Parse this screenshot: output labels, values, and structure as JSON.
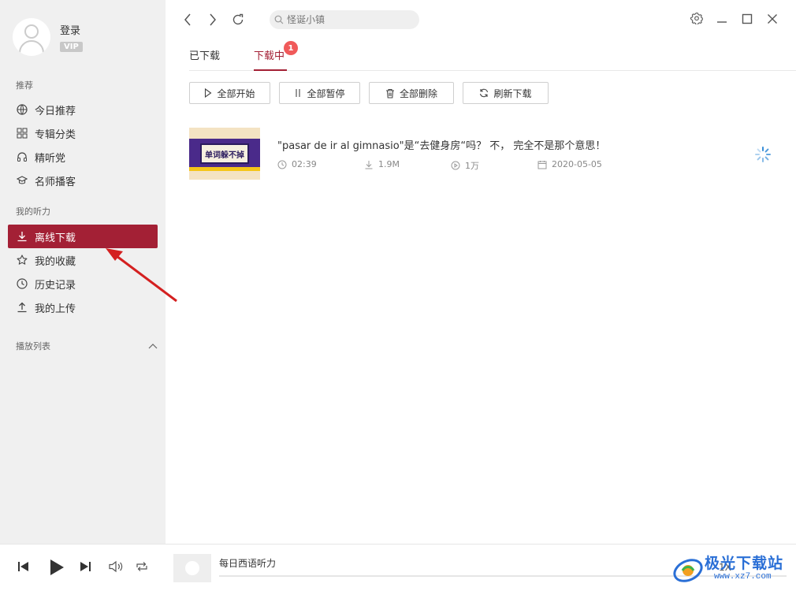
{
  "user": {
    "login_label": "登录",
    "vip_label": "VIP"
  },
  "sidebar": {
    "section_recommend": "推荐",
    "recommend_items": [
      {
        "label": "今日推荐",
        "icon": "globe-icon"
      },
      {
        "label": "专辑分类",
        "icon": "grid-icon"
      },
      {
        "label": "精听党",
        "icon": "headphones-icon"
      },
      {
        "label": "名师播客",
        "icon": "graduation-cap-icon"
      }
    ],
    "section_my": "我的听力",
    "my_items": [
      {
        "label": "离线下载",
        "icon": "download-icon",
        "active": true
      },
      {
        "label": "我的收藏",
        "icon": "star-icon"
      },
      {
        "label": "历史记录",
        "icon": "clock-icon"
      },
      {
        "label": "我的上传",
        "icon": "upload-icon"
      }
    ],
    "playlist_label": "播放列表"
  },
  "search": {
    "placeholder": "怪诞小镇"
  },
  "tabs": [
    {
      "label": "已下载"
    },
    {
      "label": "下载中",
      "active": true,
      "badge": "1"
    }
  ],
  "actions": [
    {
      "label": "全部开始",
      "icon": "play-outline-icon"
    },
    {
      "label": "全部暂停",
      "icon": "pause-icon"
    },
    {
      "label": "全部删除",
      "icon": "trash-icon"
    },
    {
      "label": "刷新下载",
      "icon": "refresh-icon"
    }
  ],
  "download_item": {
    "title": "\"pasar de ir al gimnasio\"是“去健身房“吗？ 不，  完全不是那个意思！",
    "thumb_text": "单词躲不掉",
    "duration": "02:39",
    "size": "1.9M",
    "plays": "1万",
    "date": "2020-05-05"
  },
  "player": {
    "now_playing": "每日西语听力",
    "speed": "1X",
    "progress": 0
  },
  "watermark": {
    "name": "极光下载站",
    "url": "www.xz7.com"
  },
  "colors": {
    "accent": "#a32035",
    "badge": "#f05a5a",
    "annotation_arrow": "#d42020"
  }
}
